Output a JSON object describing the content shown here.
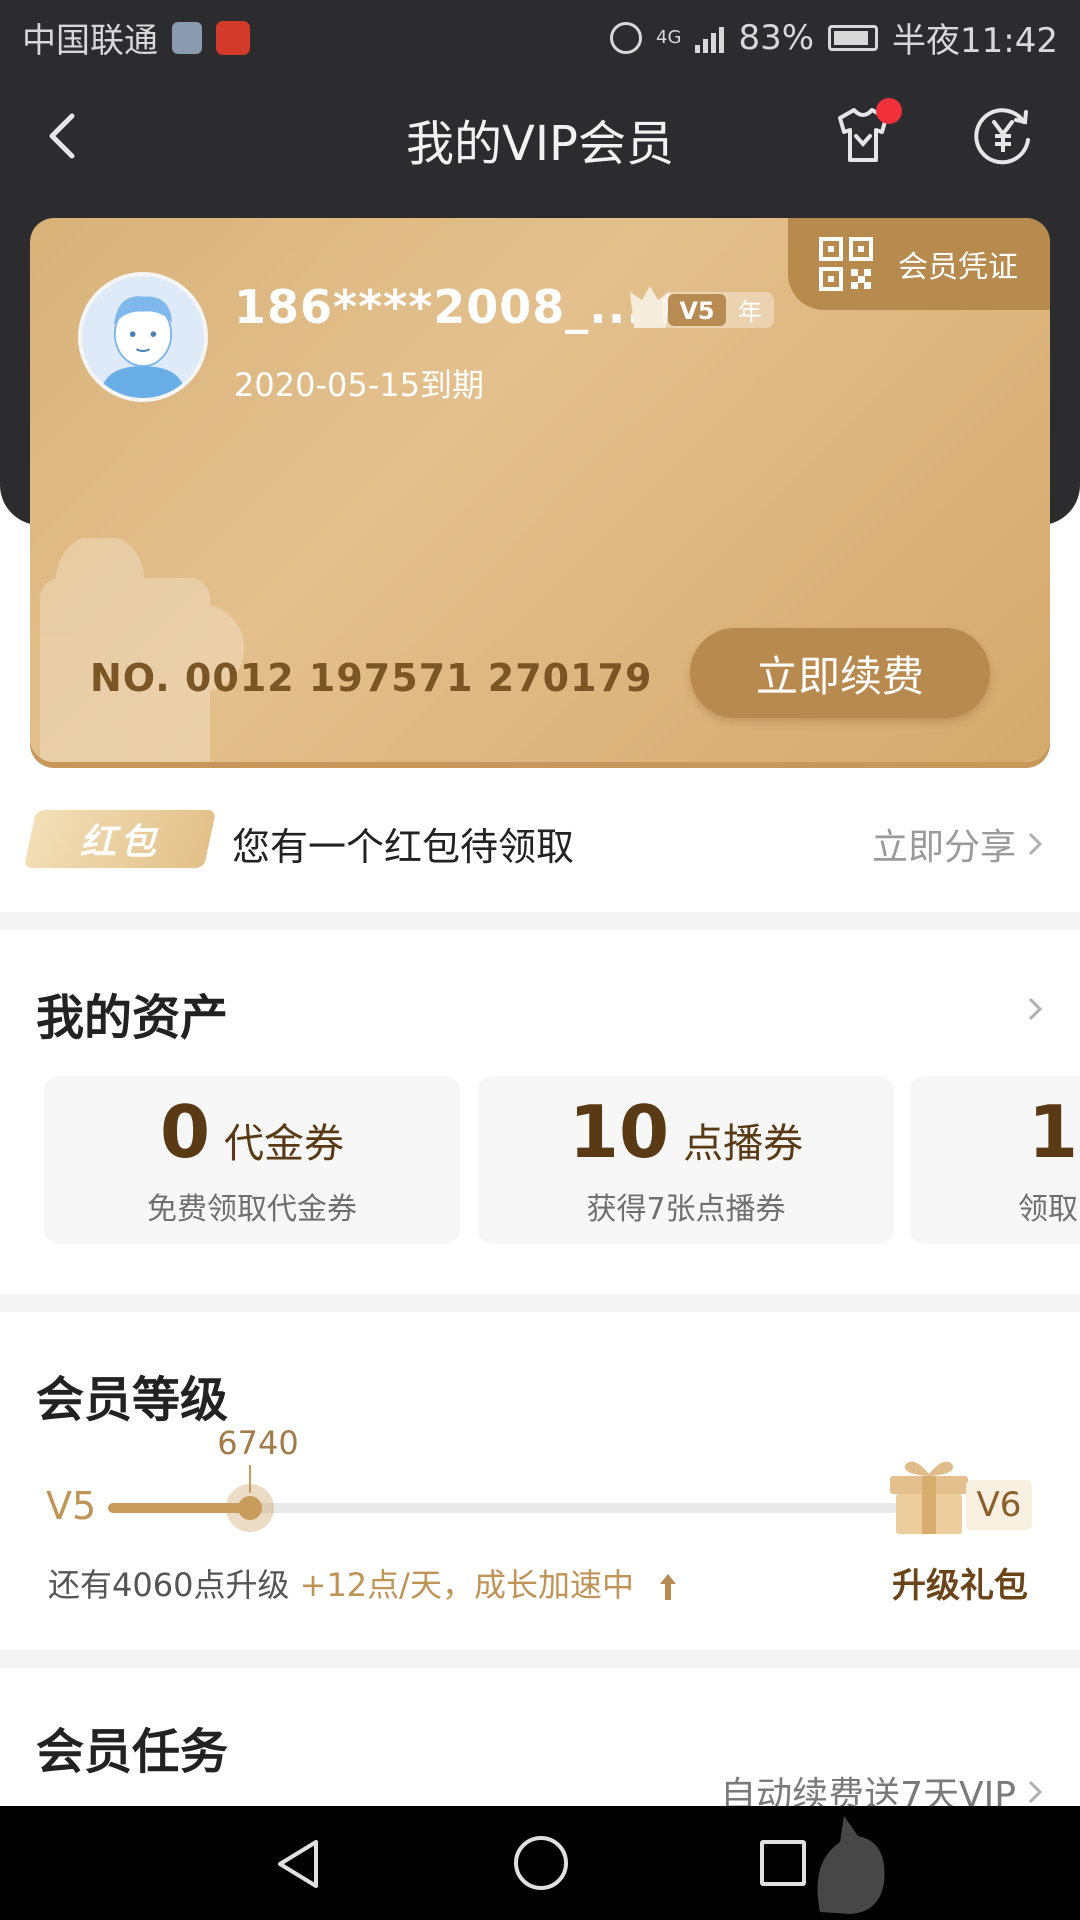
{
  "status_bar": {
    "carrier": "中国联通",
    "network": "4G",
    "battery": "83%",
    "time": "半夜11:42"
  },
  "nav": {
    "title": "我的VIP会员"
  },
  "vip_card": {
    "cert_label": "会员凭证",
    "username": "186****2008_...",
    "level_badge": "V5",
    "badge_suffix": "年",
    "expire": "2020-05-15到期",
    "card_number": "NO. 0012 197571 270179",
    "renew_label": "立即续费"
  },
  "red_packet": {
    "tag": "红包",
    "text": "您有一个红包待领取",
    "action": "立即分享"
  },
  "assets": {
    "title": "我的资产",
    "items": [
      {
        "value": "0",
        "unit": "代金券",
        "desc": "免费领取代金券"
      },
      {
        "value": "10",
        "unit": "点播券",
        "desc": "获得7张点播券"
      },
      {
        "value": "1",
        "unit": "",
        "desc": "领取"
      }
    ]
  },
  "level": {
    "title": "会员等级",
    "current_level": "V5",
    "next_level": "V6",
    "points": "6740",
    "progress_fraction": 0.18,
    "remaining": "还有4060点升级",
    "boost": "+12点/天，成长加速中",
    "gift_label": "升级礼包"
  },
  "tasks": {
    "title": "会员任务",
    "link": "自动续费送7天VIP"
  },
  "colors": {
    "header_dark": "#2c2c2e",
    "gold": "#c89a5c",
    "brown_text": "#5a3a14"
  }
}
